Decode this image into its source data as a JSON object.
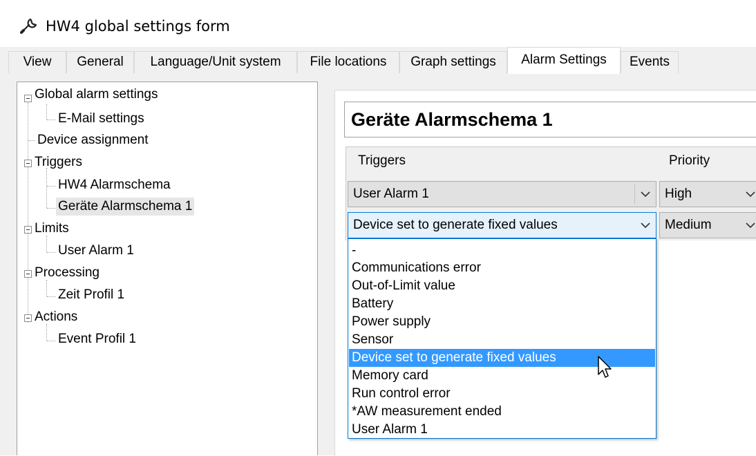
{
  "window": {
    "title": "HW4 global settings form",
    "icon": "wrench-icon"
  },
  "tabs": [
    {
      "label": "View"
    },
    {
      "label": "General"
    },
    {
      "label": "Language/Unit system"
    },
    {
      "label": "File locations"
    },
    {
      "label": "Graph settings"
    },
    {
      "label": "Alarm Settings",
      "active": true
    },
    {
      "label": "Events"
    }
  ],
  "tree": {
    "nodes": [
      {
        "label": "Global alarm settings"
      },
      {
        "label": "E-Mail settings"
      },
      {
        "label": "Device assignment"
      },
      {
        "label": "Triggers"
      },
      {
        "label": "HW4 Alarmschema"
      },
      {
        "label": "Geräte Alarmschema 1",
        "selected": true
      },
      {
        "label": "Limits"
      },
      {
        "label": "User Alarm 1"
      },
      {
        "label": "Processing"
      },
      {
        "label": "Zeit Profil 1"
      },
      {
        "label": "Actions"
      },
      {
        "label": "Event Profil 1"
      }
    ]
  },
  "detail": {
    "schema_name": "Geräte Alarmschema 1",
    "grid": {
      "headers": {
        "triggers": "Triggers",
        "priority": "Priority"
      },
      "rows": [
        {
          "trigger": "User Alarm 1",
          "priority": "High"
        },
        {
          "trigger": "Device set to generate fixed values",
          "priority": "Medium"
        }
      ]
    },
    "dropdown": {
      "options": [
        "-",
        "Communications error",
        "Out-of-Limit value",
        "Battery",
        "Power supply",
        "Sensor",
        "Device set to generate fixed values",
        "Memory card",
        "Run control error",
        "*AW measurement ended",
        "User Alarm 1"
      ],
      "highlighted": "Device set to generate fixed values"
    }
  },
  "colors": {
    "highlight": "#3399ff",
    "focus_border": "#0078d7",
    "tab_bg": "#f0f0f0"
  }
}
